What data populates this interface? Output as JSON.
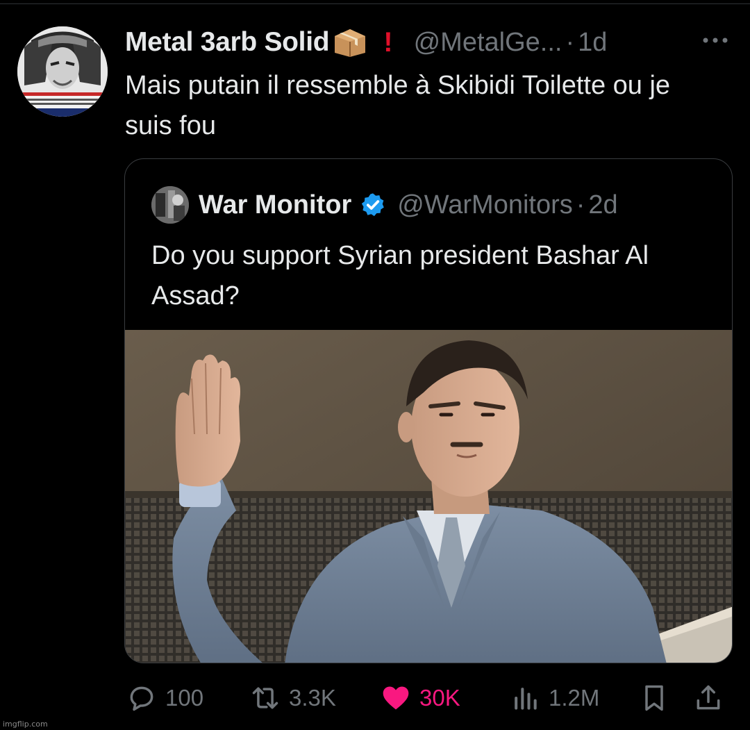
{
  "tweet": {
    "author": {
      "display_name": "Metal 3arb Solid",
      "badges": [
        "package-emoji",
        "red-exclamation-emoji"
      ],
      "handle": "@MetalGe...",
      "separator": "·",
      "time": "1d"
    },
    "text": "Mais putain il ressemble à Skibidi Toilette ou je suis fou",
    "quote": {
      "author": {
        "display_name": "War Monitor",
        "verified": true,
        "handle": "@WarMonitors",
        "separator": "·",
        "time": "2d"
      },
      "text": "Do you support Syrian president Bashar Al Assad?",
      "media": {
        "type": "photo"
      }
    },
    "actions": {
      "replies": "100",
      "reposts": "3.3K",
      "likes": "30K",
      "views": "1.2M"
    }
  },
  "colors": {
    "background": "#000000",
    "text_primary": "#e7e9ea",
    "text_secondary": "#71767b",
    "like_pink": "#f91880",
    "verified_blue": "#1d9bf0"
  },
  "watermark": "imgflip.com"
}
